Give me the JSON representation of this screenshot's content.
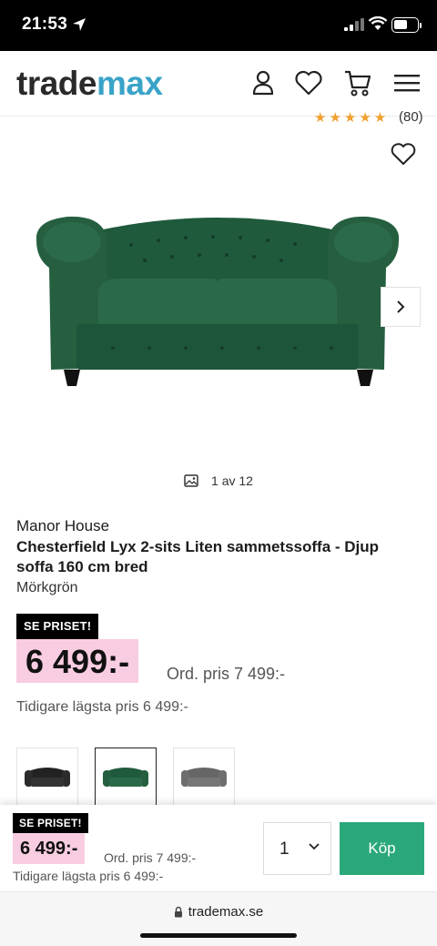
{
  "status_bar": {
    "time": "21:53"
  },
  "header": {
    "logo_part1": "trade",
    "logo_part2": "max",
    "icons": [
      "user-icon",
      "heart-icon",
      "cart-icon",
      "menu-icon"
    ]
  },
  "gallery": {
    "rating_count": "(80)",
    "counter": "1 av 12"
  },
  "product": {
    "brand": "Manor House",
    "title": "Chesterfield Lyx 2-sits Liten sammetssoffa - Djup soffa 160 cm bred",
    "variant": "Mörkgrön",
    "badge": "SE PRISET!",
    "price": "6 499:-",
    "ord_price": "Ord. pris 7 499:-",
    "lowest_price": "Tidigare lägsta pris 6 499:-",
    "color_options": [
      "black",
      "dark-green",
      "grey"
    ],
    "selected_option": "dark-green"
  },
  "buy_bar": {
    "badge": "SE PRISET!",
    "price": "6 499:-",
    "ord_price": "Ord. pris 7 499:-",
    "lowest_price": "Tidigare lägsta pris 6 499:-",
    "quantity": "1",
    "buy_label": "Köp"
  },
  "browser": {
    "url": "trademax.se"
  },
  "colors": {
    "logo_accent": "#3aa3c8",
    "price_highlight": "#f9cde1",
    "buy_button": "#2ba87a",
    "sofa_green": "#1f5a3c",
    "star": "#f0a030"
  }
}
